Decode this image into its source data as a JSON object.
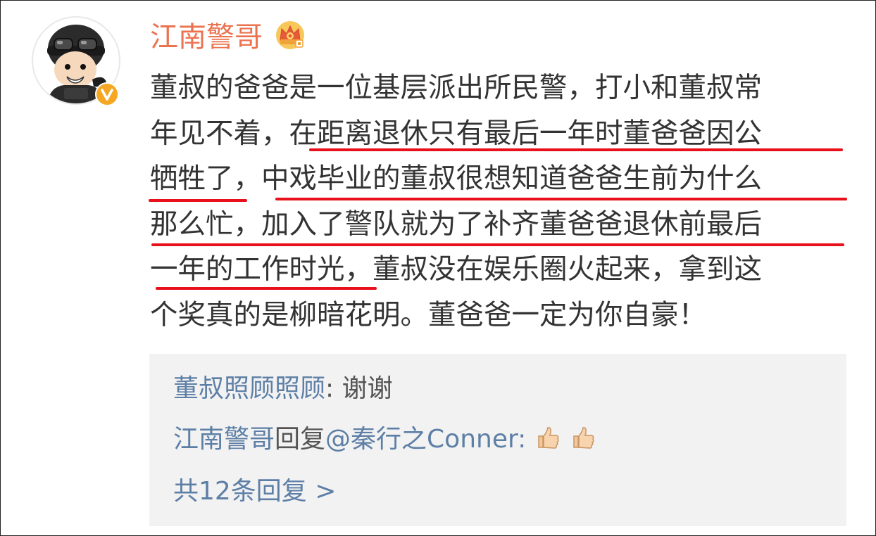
{
  "post": {
    "author": "江南警哥",
    "author_badge_icon": "crown-icon",
    "verified_icon": "verified-v-icon",
    "lines": [
      "董叔的爸爸是一位基层派出所民警，打小和董叔常",
      "年见不着，在距离退休只有最后一年时董爸爸因公",
      "牺牲了，中戏毕业的董叔很想知道爸爸生前为什么",
      "那么忙，加入了警队就为了补齐董爸爸退休前最后",
      "一年的工作时光，董叔没在娱乐圈火起来，拿到这",
      "个奖真的是柳暗花明。董爸爸一定为你自豪！"
    ],
    "underline_color": "#e8101a"
  },
  "replies": {
    "reply1": {
      "user": "董叔照顾照顾",
      "sep": ": ",
      "text": "谢谢"
    },
    "reply2": {
      "user": "江南警哥",
      "action": "回复",
      "mention": "@秦行之Conner:",
      "emoji_icon": "thumbs-up-icon"
    },
    "more": "共12条回复 >"
  },
  "colors": {
    "username": "#eb7350",
    "link": "#5d7fa6",
    "text": "#333333",
    "reply_bg": "#f2f2f2"
  }
}
